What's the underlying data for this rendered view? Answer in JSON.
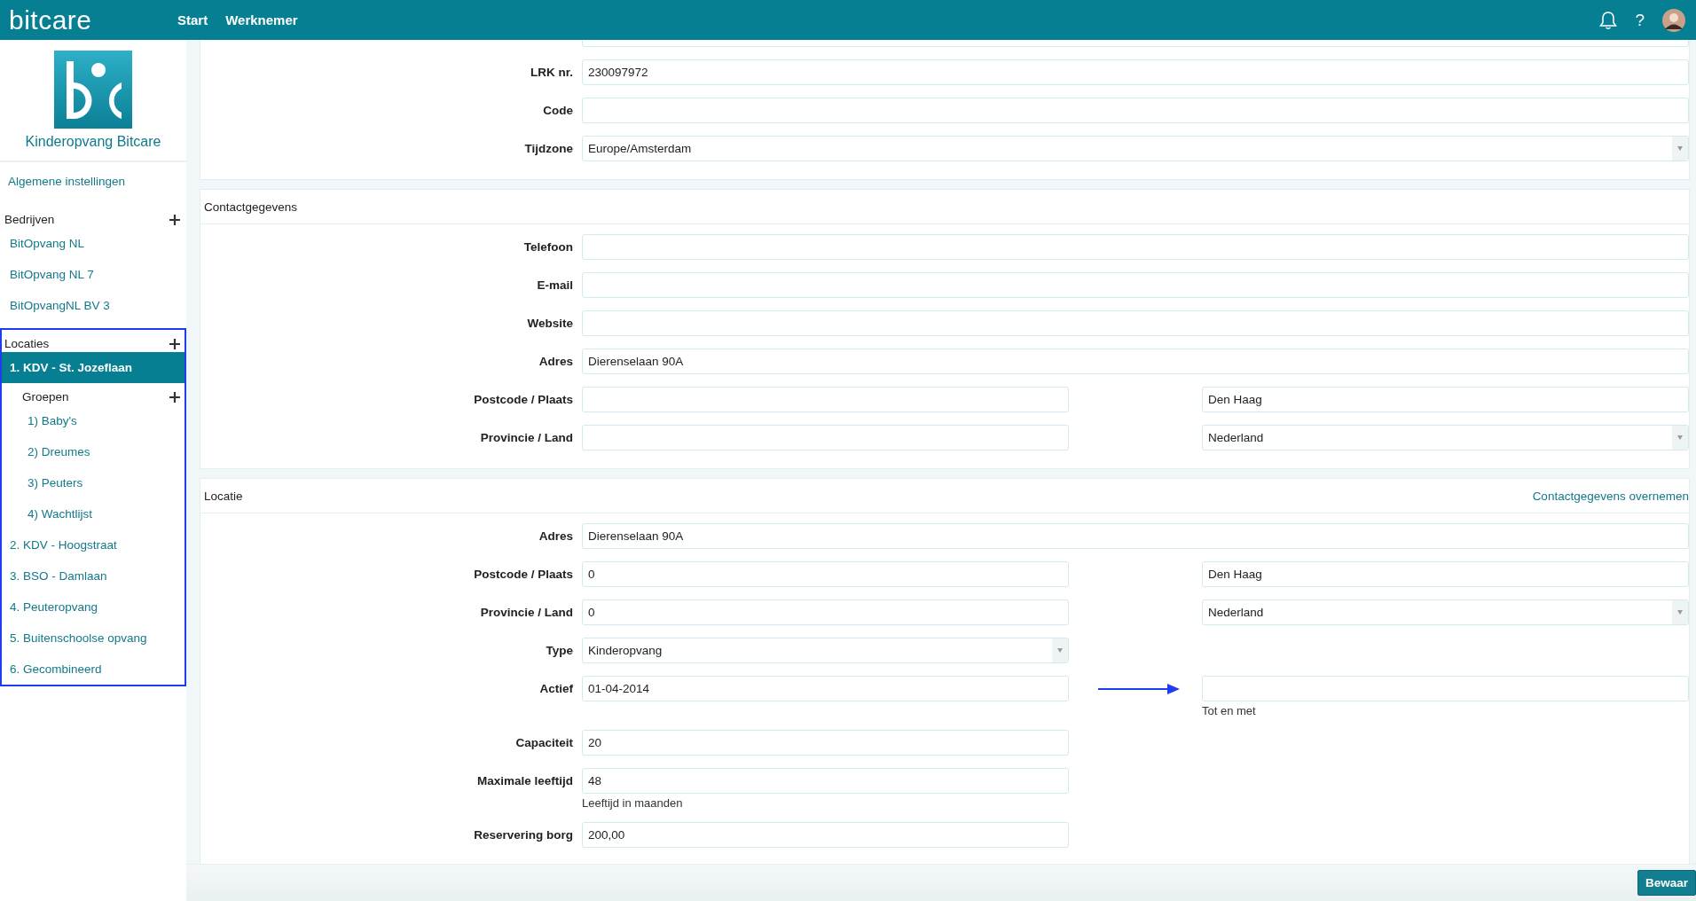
{
  "topbar": {
    "brand": "bitcare",
    "nav": [
      {
        "label": "Start",
        "selected": false
      },
      {
        "label": "Werknemer",
        "selected": false
      }
    ],
    "help": "?"
  },
  "sidebar": {
    "caption": "Kinderopvang Bitcare",
    "general": "Algemene instellingen",
    "sections": [
      {
        "title": "Bedrijven",
        "highlighted": false,
        "items": [
          {
            "label": "BitOpvang NL",
            "selected": false
          },
          {
            "label": "BitOpvang NL 7",
            "selected": false
          },
          {
            "label": "BitOpvangNL BV 3",
            "selected": false
          }
        ]
      },
      {
        "title": "Locaties",
        "highlighted": true,
        "items": [
          {
            "label": "1. KDV - St. Jozeflaan",
            "selected": true,
            "groups": {
              "title": "Groepen",
              "items": [
                {
                  "label": "1) Baby's",
                  "selected": false
                },
                {
                  "label": "2) Dreumes",
                  "selected": false
                },
                {
                  "label": "3) Peuters",
                  "selected": false
                },
                {
                  "label": "4) Wachtlijst",
                  "selected": false
                }
              ]
            }
          },
          {
            "label": "2. KDV - Hoogstraat",
            "selected": false
          },
          {
            "label": "3. BSO - Damlaan",
            "selected": false
          },
          {
            "label": "4. Peuteropvang",
            "selected": false
          },
          {
            "label": "5. Buitenschoolse opvang",
            "selected": false
          },
          {
            "label": "6. Gecombineerd",
            "selected": false
          }
        ]
      }
    ]
  },
  "panels": [
    {
      "rows": [
        {
          "kind": "full",
          "fields": [
            {
              "kind": "text"
            }
          ]
        },
        {
          "label": "LRK nr.",
          "kind": "full",
          "fields": [
            {
              "kind": "text",
              "value": "230097972"
            }
          ]
        },
        {
          "label": "Code",
          "kind": "full",
          "fields": [
            {
              "kind": "text"
            }
          ]
        },
        {
          "label": "Tijdzone",
          "kind": "full",
          "fields": [
            {
              "kind": "select",
              "value": "Europe/Amsterdam"
            }
          ]
        }
      ]
    },
    {
      "title": "Contactgegevens",
      "rows": [
        {
          "label": "Telefoon",
          "kind": "full",
          "fields": [
            {
              "kind": "text"
            }
          ]
        },
        {
          "label": "E-mail",
          "kind": "full",
          "fields": [
            {
              "kind": "text"
            }
          ]
        },
        {
          "label": "Website",
          "kind": "full",
          "fields": [
            {
              "kind": "text"
            }
          ]
        },
        {
          "label": "Adres",
          "kind": "full",
          "fields": [
            {
              "kind": "text",
              "value": "Dierenselaan 90A"
            }
          ]
        },
        {
          "label": "Postcode / Plaats",
          "kind": "half",
          "fields": [
            {
              "kind": "text"
            },
            {
              "kind": "text",
              "value": "Den Haag"
            }
          ]
        },
        {
          "label": "Provincie / Land",
          "kind": "half",
          "fields": [
            {
              "kind": "text"
            },
            {
              "kind": "select",
              "value": "Nederland"
            }
          ]
        }
      ]
    },
    {
      "title": "Locatie",
      "action": "Contactgegevens overnemen",
      "rows": [
        {
          "label": "Adres",
          "kind": "full",
          "fields": [
            {
              "kind": "text",
              "value": "Dierenselaan 90A"
            }
          ]
        },
        {
          "label": "Postcode / Plaats",
          "kind": "half",
          "fields": [
            {
              "kind": "text",
              "value": "0"
            },
            {
              "kind": "text",
              "value": "Den Haag"
            }
          ]
        },
        {
          "label": "Provincie / Land",
          "kind": "half",
          "fields": [
            {
              "kind": "text",
              "value": "0"
            },
            {
              "kind": "select",
              "value": "Nederland"
            }
          ]
        },
        {
          "label": "Type",
          "kind": "half",
          "fields": [
            {
              "kind": "select",
              "value": "Kinderopvang"
            }
          ]
        },
        {
          "label": "Actief",
          "kind": "half",
          "arrow": true,
          "fields": [
            {
              "kind": "text",
              "value": "01-04-2014"
            },
            {
              "kind": "text",
              "help": "Tot en met"
            }
          ]
        },
        {
          "label": "Capaciteit",
          "kind": "half",
          "fields": [
            {
              "kind": "text",
              "value": "20"
            }
          ]
        },
        {
          "label": "Maximale leeftijd",
          "kind": "half",
          "fields": [
            {
              "kind": "text",
              "value": "48",
              "help": "Leeftijd in maanden"
            }
          ]
        },
        {
          "label": "Reservering borg",
          "kind": "half",
          "fields": [
            {
              "kind": "text",
              "value": "200,00"
            }
          ]
        }
      ]
    }
  ],
  "footer": {
    "save": "Bewaar"
  }
}
